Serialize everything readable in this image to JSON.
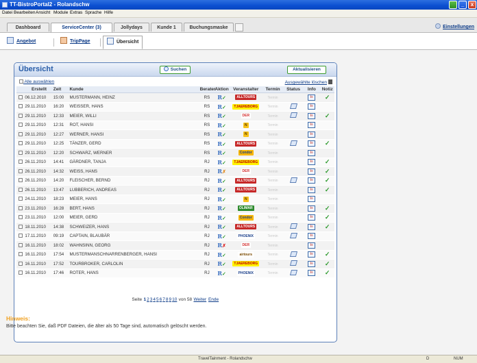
{
  "window": {
    "title": "TT-BistroPortal2 - Rolandschw"
  },
  "menu": [
    "Datei",
    "Bearbeiten",
    "Ansicht",
    "Module",
    "Extras",
    "Sprache",
    "Hilfe"
  ],
  "tabs": [
    {
      "label": "Dashboard"
    },
    {
      "label": "ServiceCenter (3)"
    },
    {
      "label": "Jollydays"
    },
    {
      "label": "Kunde 1"
    },
    {
      "label": "Buchungsmaske"
    }
  ],
  "settings_label": "Einstellungen",
  "subtabs": [
    {
      "label": "Angebot"
    },
    {
      "label": "TripPage"
    },
    {
      "label": "Übersicht"
    }
  ],
  "panel": {
    "title": "Übersicht",
    "search_label": "Suchen",
    "refresh_label": "Aktualisieren",
    "select_all": "Alle auswählen",
    "delete_selected": "Ausgewählte löschen"
  },
  "columns": [
    "Erstellt",
    "Zeit",
    "Kunde",
    "Berater",
    "Aktion",
    "Veranstalter",
    "Termin",
    "Status",
    "Info",
    "Notiz"
  ],
  "termin_placeholder": "Termin",
  "rows": [
    {
      "date": "06.12.2010",
      "time": "15:00",
      "customer": "MUSTERMANN, HEINZ",
      "agent": "RS",
      "action": "ok",
      "operator": "ALLTOURS",
      "status": false,
      "note": true
    },
    {
      "date": "29.11.2010",
      "time": "16:20",
      "customer": "WEISSER, HANS",
      "agent": "RS",
      "action": "ok",
      "operator": "TJAEREBORG",
      "status": true,
      "note": false
    },
    {
      "date": "29.11.2010",
      "time": "12:33",
      "customer": "MEIER, WILLI",
      "agent": "RS",
      "action": "ok",
      "operator": "DER",
      "status": true,
      "note": true
    },
    {
      "date": "29.11.2010",
      "time": "12:31",
      "customer": "ROT, HANSI",
      "agent": "RS",
      "action": "ok",
      "operator": "N",
      "status": false,
      "note": false
    },
    {
      "date": "29.11.2010",
      "time": "12:27",
      "customer": "WERNER, HANSI",
      "agent": "RS",
      "action": "ok",
      "operator": "N",
      "status": false,
      "note": false
    },
    {
      "date": "29.11.2010",
      "time": "12:25",
      "customer": "TÄNZER, GERD",
      "agent": "RS",
      "action": "ok",
      "operator": "ALLTOURS",
      "status": true,
      "note": true
    },
    {
      "date": "29.11.2010",
      "time": "12:20",
      "customer": "SCHWARZ, WERNER",
      "agent": "RS",
      "action": "ok",
      "operator": "Condor",
      "status": false,
      "note": false
    },
    {
      "date": "26.11.2010",
      "time": "14:41",
      "customer": "GÄRDNER, TANJA",
      "agent": "RJ",
      "action": "ok",
      "operator": "TJAEREBORG",
      "status": false,
      "note": true
    },
    {
      "date": "26.11.2010",
      "time": "14:32",
      "customer": "WEISS, HANS",
      "agent": "RJ",
      "action": "warn",
      "operator": "DER",
      "status": false,
      "note": true
    },
    {
      "date": "26.11.2010",
      "time": "14:20",
      "customer": "FLEISCHER, BERND",
      "agent": "RJ",
      "action": "ok",
      "operator": "ALLTOURS",
      "status": true,
      "note": true
    },
    {
      "date": "26.11.2010",
      "time": "13:47",
      "customer": "LUBBERICH, ANDREAS",
      "agent": "RJ",
      "action": "ok",
      "operator": "ALLTOURS",
      "status": false,
      "note": true
    },
    {
      "date": "24.11.2010",
      "time": "18:23",
      "customer": "MEIER, HANS",
      "agent": "RJ",
      "action": "ok",
      "operator": "N",
      "status": false,
      "note": false
    },
    {
      "date": "23.11.2010",
      "time": "16:28",
      "customer": "BERT, HANS",
      "agent": "RJ",
      "action": "ok",
      "operator": "OLIMAR",
      "status": false,
      "note": true
    },
    {
      "date": "23.11.2010",
      "time": "12:00",
      "customer": "MEIER, GERD",
      "agent": "RJ",
      "action": "ok",
      "operator": "Condor",
      "status": false,
      "note": true
    },
    {
      "date": "18.11.2010",
      "time": "14:38",
      "customer": "SCHWEIZER, HANS",
      "agent": "RJ",
      "action": "ok",
      "operator": "ALLTOURS",
      "status": true,
      "note": true
    },
    {
      "date": "17.11.2010",
      "time": "09:19",
      "customer": "CAPTAIN, BLAUBÄR",
      "agent": "RJ",
      "action": "ok",
      "operator": "PHOENIX",
      "status": true,
      "note": false
    },
    {
      "date": "16.11.2010",
      "time": "18:02",
      "customer": "WAHNSINN, GEORG",
      "agent": "RJ",
      "action": "bad",
      "operator": "DER",
      "status": false,
      "note": false
    },
    {
      "date": "16.11.2010",
      "time": "17:54",
      "customer": "MUSTERMANSCHNARRENBERGER, HANSI",
      "agent": "RJ",
      "action": "ok",
      "operator": "airtours",
      "status": true,
      "note": true
    },
    {
      "date": "16.11.2010",
      "time": "17:52",
      "customer": "TOURBROKER, CARLOLIN",
      "agent": "RJ",
      "action": "ok",
      "operator": "TJAEREBORG",
      "status": true,
      "note": true
    },
    {
      "date": "16.11.2010",
      "time": "17:46",
      "customer": "ROTER, HANS",
      "agent": "RJ",
      "action": "ok",
      "operator": "PHOENIX",
      "status": true,
      "note": true
    }
  ],
  "pagination": {
    "prefix": "Seite",
    "pages": [
      "1",
      "2",
      "3",
      "4",
      "5",
      "6",
      "7",
      "8",
      "9",
      "10"
    ],
    "current": "1",
    "suffix": "von 58",
    "next": "Weiter",
    "end": "Ende"
  },
  "hint": {
    "title": "Hinweis:",
    "text": "Bitte beachten Sie, daß PDF Dateien, die älter als 50 Tage sind, automatisch gelöscht werden."
  },
  "statusbar": {
    "center": "TravelTainment - Rolandschw",
    "d": "D",
    "num": "NUM"
  },
  "colors": {
    "accent": "#2a5ea8",
    "check": "#2e9a2e",
    "hint": "#f0a020"
  },
  "operator_styles": {
    "ALLTOURS": {
      "bg": "#c62828",
      "fg": "#ffffff"
    },
    "TJAEREBORG": {
      "bg": "#fff200",
      "fg": "#c00000"
    },
    "DER": {
      "bg": "#ffffff",
      "fg": "#d32f2f"
    },
    "N": {
      "bg": "#f7c21a",
      "fg": "#5a3b00"
    },
    "Condor": {
      "bg": "#f7b500",
      "fg": "#1a3f8a"
    },
    "OLIMAR": {
      "bg": "#2e8b2e",
      "fg": "#ffffff"
    },
    "PHOENIX": {
      "bg": "#ffffff",
      "fg": "#1a3f8a"
    },
    "airtours": {
      "bg": "#ffffff",
      "fg": "#7a4a00"
    }
  }
}
